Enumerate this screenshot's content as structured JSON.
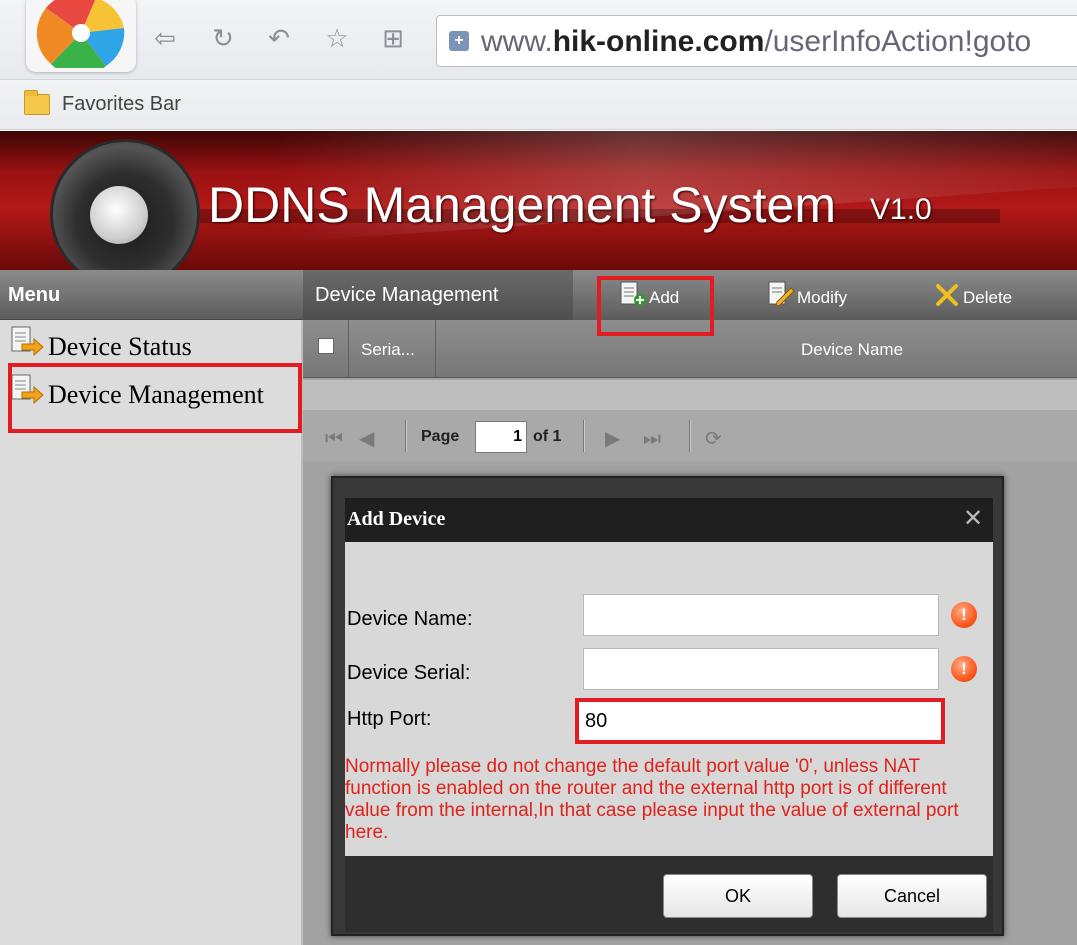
{
  "browser": {
    "url_prefix": "www.",
    "url_domain": "hik-online.com",
    "url_path": "/userInfoAction!goto",
    "favorites_label": "Favorites Bar"
  },
  "banner": {
    "title": "DDNS Management System",
    "version": "V1.0"
  },
  "menu": {
    "title": "Menu",
    "items": [
      {
        "label": "Device Status"
      },
      {
        "label": "Device Management"
      }
    ]
  },
  "main": {
    "tab": "Device Management",
    "toolbar": {
      "add": "Add",
      "modify": "Modify",
      "delete": "Delete"
    },
    "grid": {
      "columns": [
        "Seria...",
        "Device Name"
      ]
    },
    "pager": {
      "page_label": "Page",
      "page_value": "1",
      "of_label": "of 1"
    }
  },
  "dialog": {
    "title": "Add Device",
    "fields": [
      {
        "label": "Device Name:",
        "value": ""
      },
      {
        "label": "Device Serial:",
        "value": ""
      },
      {
        "label": "Http Port:",
        "value": "80"
      }
    ],
    "note": "Normally please do not change the default port value '0', unless NAT function is enabled on the router and the external http port is of different value from the internal,In that case please input the value of external port here.",
    "ok": "OK",
    "cancel": "Cancel"
  },
  "colors": {
    "highlight": "#e31b23",
    "banner": "#b21818",
    "note_text": "#e0221a"
  }
}
